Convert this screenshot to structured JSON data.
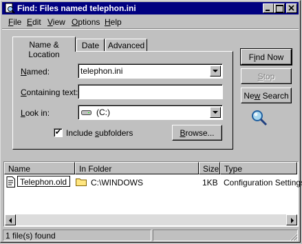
{
  "window": {
    "title": "Find: Files named telephon.ini"
  },
  "menu": [
    {
      "label": "File",
      "accel": "F",
      "rest": "ile"
    },
    {
      "label": "Edit",
      "accel": "E",
      "rest": "dit"
    },
    {
      "label": "View",
      "accel": "V",
      "rest": "iew"
    },
    {
      "label": "Options",
      "accel": "O",
      "rest": "ptions"
    },
    {
      "label": "Help",
      "accel": "H",
      "rest": "elp"
    }
  ],
  "tabs": [
    {
      "label": "Name & Location",
      "active": true
    },
    {
      "label": "Date",
      "active": false
    },
    {
      "label": "Advanced",
      "active": false
    }
  ],
  "form": {
    "named_label_accel": "N",
    "named_label_rest": "amed:",
    "named_value": "telephon.ini",
    "containing_label_accel": "C",
    "containing_label_rest": "ontaining text:",
    "containing_value": "",
    "lookin_label_accel": "L",
    "lookin_label_rest": "ook in:",
    "lookin_value": "(C:)",
    "include_pre": "Include ",
    "include_accel": "s",
    "include_post": "ubfolders",
    "include_checked": true,
    "browse_accel": "B",
    "browse_rest": "rowse..."
  },
  "buttons": {
    "find_now_accel": "i",
    "find_now_pre": "F",
    "find_now_post": "nd Now",
    "stop_accel": "S",
    "stop_rest": "top",
    "new_search_pre": "Ne",
    "new_search_accel": "w",
    "new_search_post": " Search"
  },
  "results": {
    "columns": [
      "Name",
      "In Folder",
      "Size",
      "Type"
    ],
    "rows": [
      {
        "name": "Telephon.old",
        "folder": "C:\\WINDOWS",
        "size": "1KB",
        "type": "Configuration Settings"
      }
    ]
  },
  "status": {
    "text": "1 file(s) found"
  },
  "colors": {
    "titlebar": "#000080",
    "face": "#c0c0c0",
    "selection_outline": "#000000"
  }
}
